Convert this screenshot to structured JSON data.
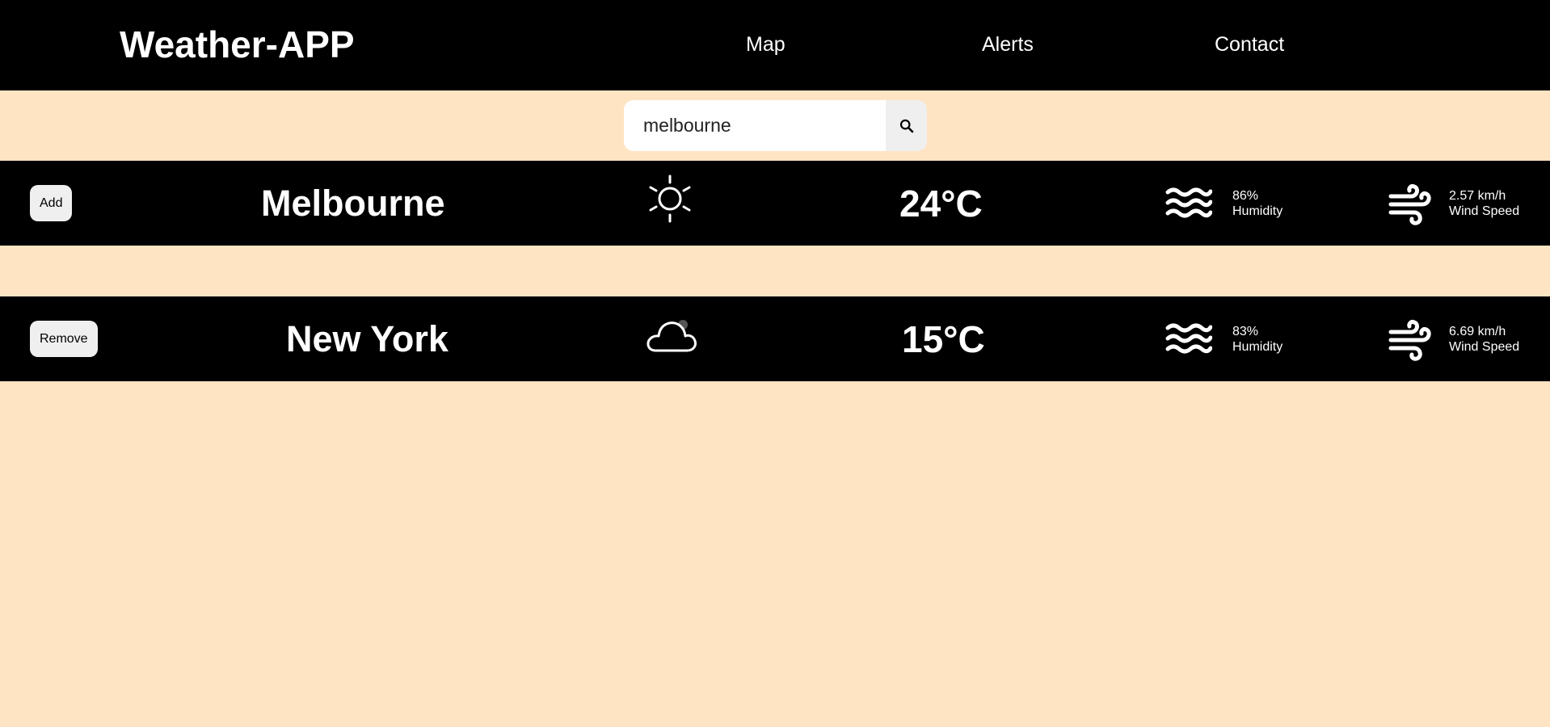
{
  "header": {
    "brand": "Weather-APP",
    "nav": [
      "Map",
      "Alerts",
      "Contact"
    ]
  },
  "search": {
    "value": "melbourne",
    "icon": "search-icon"
  },
  "cards": [
    {
      "button_label": "Add",
      "city": "Melbourne",
      "condition_icon": "sun-icon",
      "temperature": "24°C",
      "humidity_value": "86%",
      "humidity_label": "Humidity",
      "wind_value": "2.57 km/h",
      "wind_label": "Wind Speed"
    },
    {
      "button_label": "Remove",
      "city": "New York",
      "condition_icon": "cloud-icon",
      "temperature": "15°C",
      "humidity_value": "83%",
      "humidity_label": "Humidity",
      "wind_value": "6.69 km/h",
      "wind_label": "Wind Speed"
    }
  ],
  "colors": {
    "page_background": "#ffe4c4",
    "bar_background": "#000000",
    "text_on_bar": "#ffffff",
    "button_background": "#efefef"
  }
}
